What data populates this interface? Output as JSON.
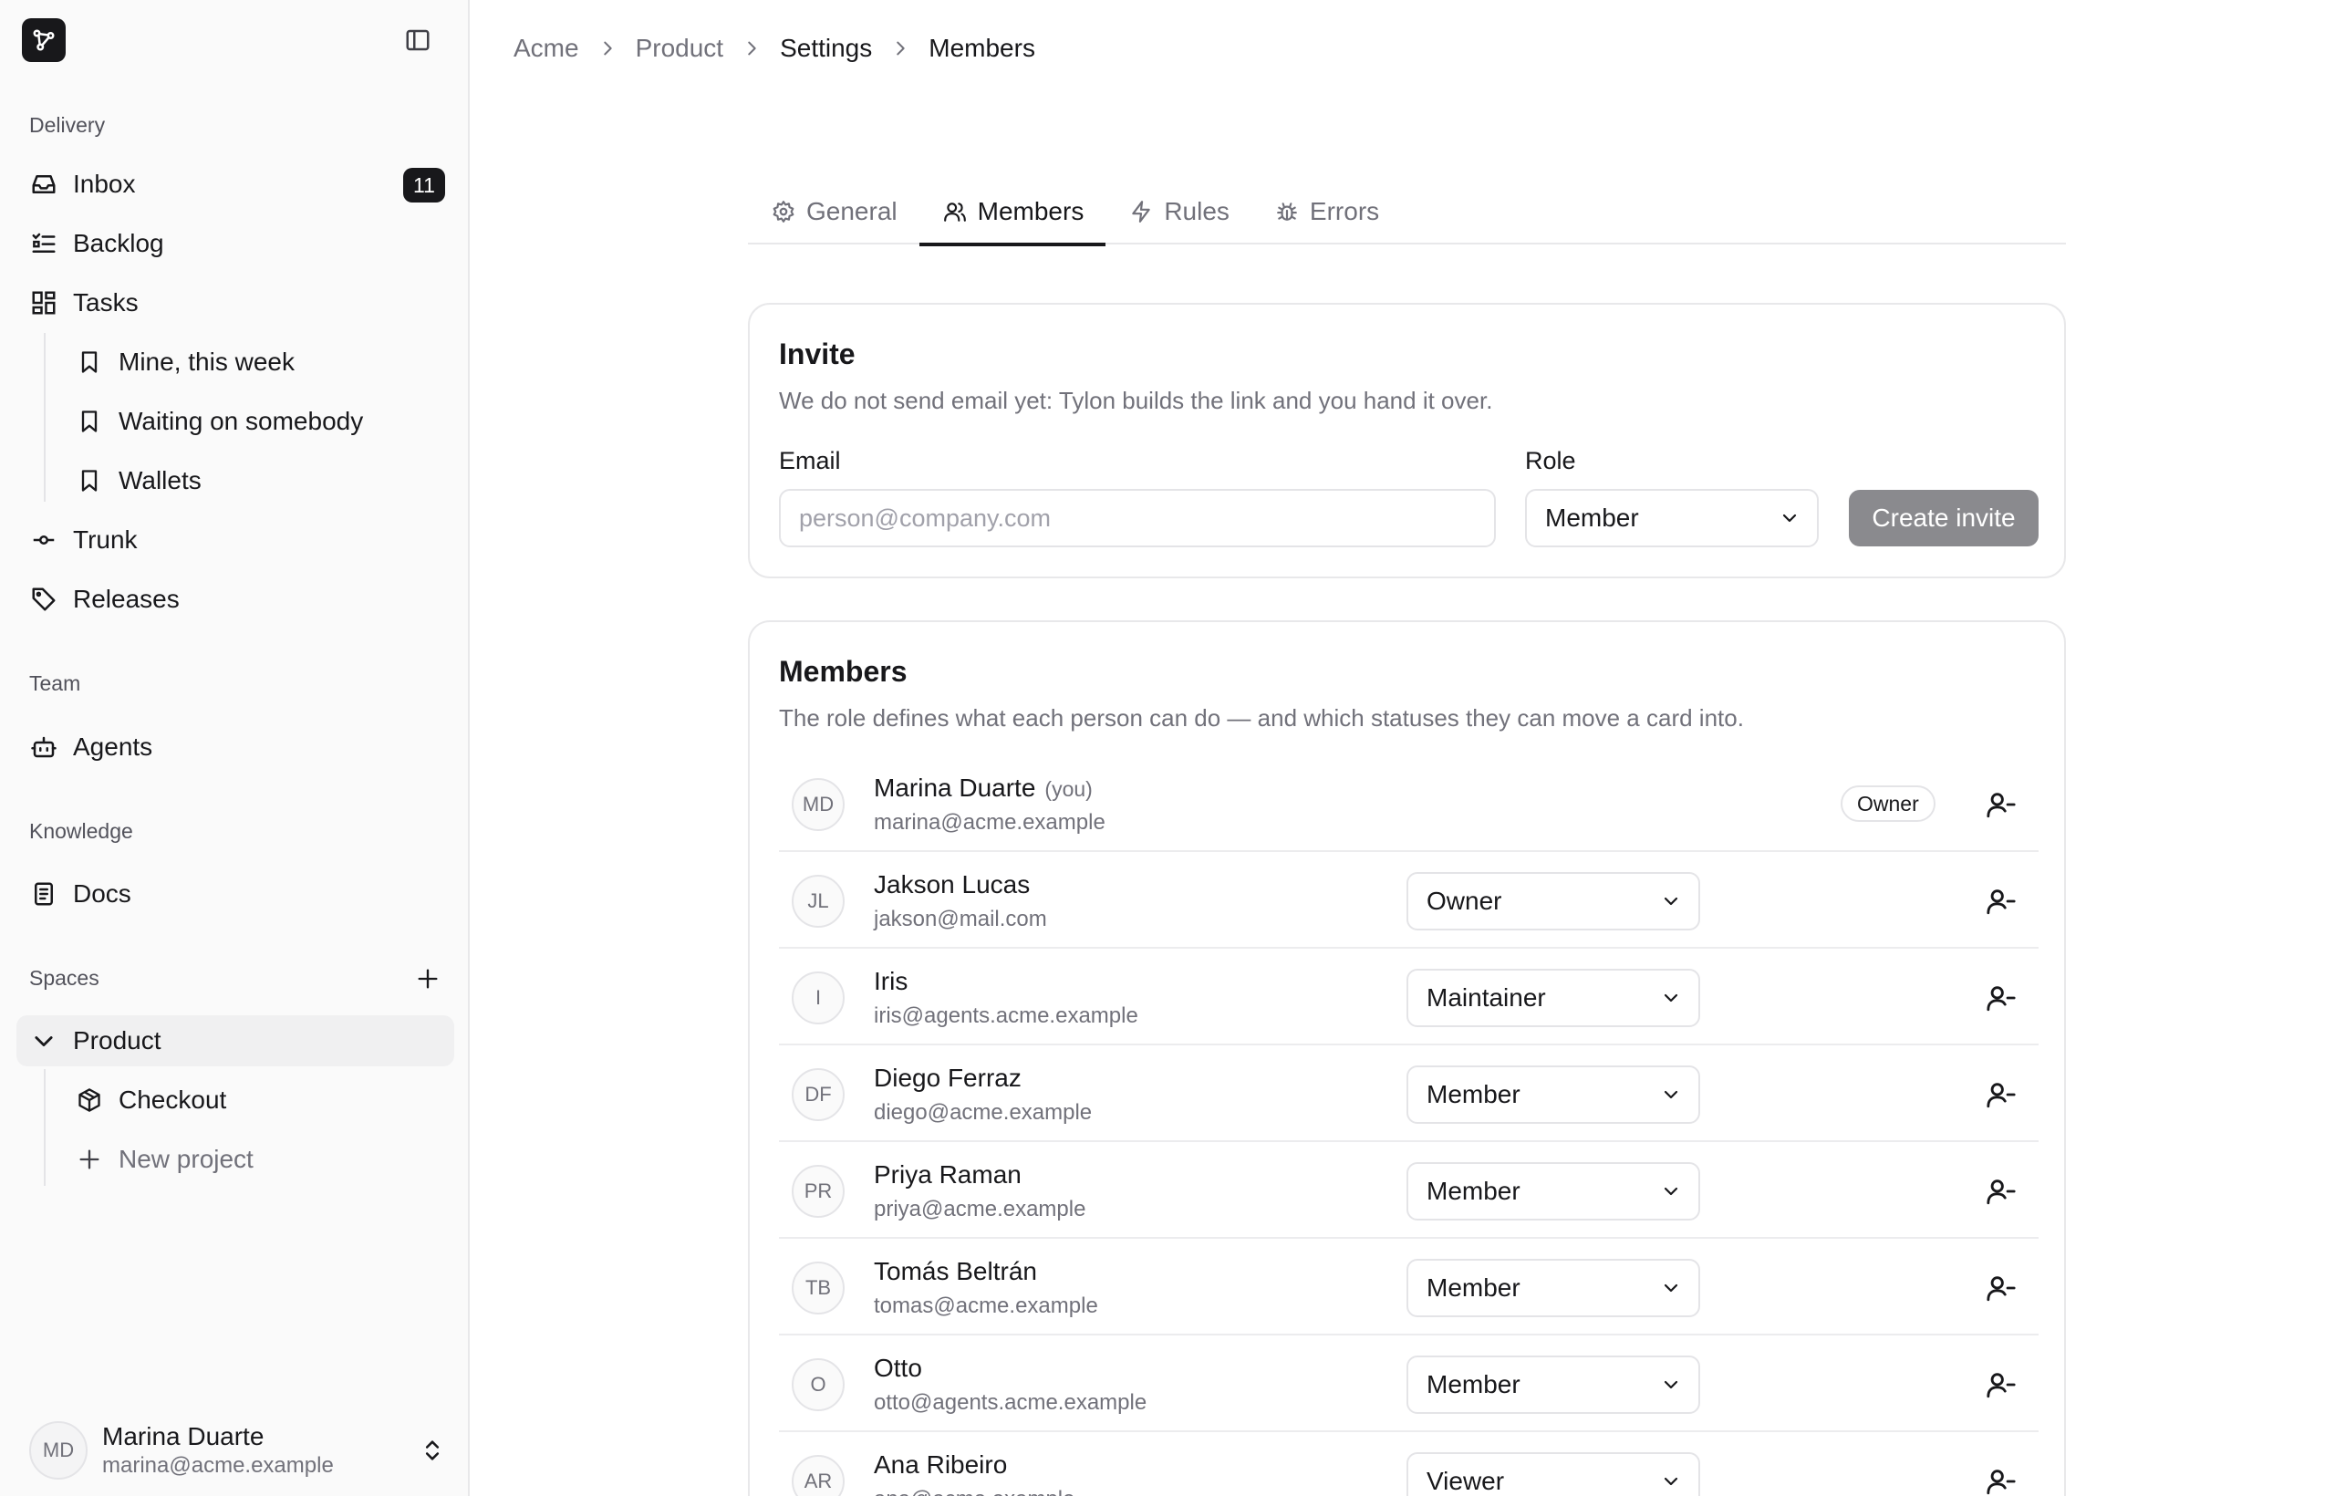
{
  "sidebar": {
    "sections": {
      "delivery": "Delivery",
      "team": "Team",
      "knowledge": "Knowledge",
      "spaces": "Spaces"
    },
    "items": {
      "inbox": {
        "label": "Inbox",
        "count": "11",
        "icon": "inbox-icon"
      },
      "backlog": {
        "label": "Backlog",
        "icon": "list-check-icon"
      },
      "tasks": {
        "label": "Tasks",
        "icon": "grid-icon"
      },
      "mine": {
        "label": "Mine, this week",
        "icon": "bookmark-icon"
      },
      "waiting": {
        "label": "Waiting on somebody",
        "icon": "bookmark-icon"
      },
      "wallets": {
        "label": "Wallets",
        "icon": "bookmark-icon"
      },
      "trunk": {
        "label": "Trunk",
        "icon": "commit-icon"
      },
      "releases": {
        "label": "Releases",
        "icon": "tag-icon"
      },
      "agents": {
        "label": "Agents",
        "icon": "bot-icon"
      },
      "docs": {
        "label": "Docs",
        "icon": "document-icon"
      },
      "product": {
        "label": "Product",
        "icon": "chevron-down-icon"
      },
      "checkout": {
        "label": "Checkout",
        "icon": "package-icon"
      },
      "new_project": {
        "label": "New project",
        "icon": "plus-icon"
      }
    },
    "user": {
      "initials": "MD",
      "name": "Marina Duarte",
      "email": "marina@acme.example"
    }
  },
  "breadcrumb": [
    "Acme",
    "Product",
    "Settings",
    "Members"
  ],
  "tabs": [
    {
      "label": "General",
      "icon": "gear-icon",
      "active": false
    },
    {
      "label": "Members",
      "icon": "users-icon",
      "active": true
    },
    {
      "label": "Rules",
      "icon": "bolt-icon",
      "active": false
    },
    {
      "label": "Errors",
      "icon": "bug-icon",
      "active": false
    }
  ],
  "invite": {
    "title": "Invite",
    "description": "We do not send email yet: Tylon builds the link and you hand it over.",
    "email_label": "Email",
    "email_placeholder": "person@company.com",
    "email_value": "",
    "role_label": "Role",
    "role_value": "Member",
    "submit_label": "Create invite"
  },
  "members": {
    "title": "Members",
    "description": "The role defines what each person can do — and which statuses they can move a card into.",
    "you_label": "(you)",
    "rows": [
      {
        "initials": "MD",
        "name": "Marina Duarte",
        "email": "marina@acme.example",
        "role": "Owner",
        "is_you": true
      },
      {
        "initials": "JL",
        "name": "Jakson Lucas",
        "email": "jakson@mail.com",
        "role": "Owner",
        "is_you": false
      },
      {
        "initials": "I",
        "name": "Iris",
        "email": "iris@agents.acme.example",
        "role": "Maintainer",
        "is_you": false
      },
      {
        "initials": "DF",
        "name": "Diego Ferraz",
        "email": "diego@acme.example",
        "role": "Member",
        "is_you": false
      },
      {
        "initials": "PR",
        "name": "Priya Raman",
        "email": "priya@acme.example",
        "role": "Member",
        "is_you": false
      },
      {
        "initials": "TB",
        "name": "Tomás Beltrán",
        "email": "tomas@acme.example",
        "role": "Member",
        "is_you": false
      },
      {
        "initials": "O",
        "name": "Otto",
        "email": "otto@agents.acme.example",
        "role": "Member",
        "is_you": false
      },
      {
        "initials": "AR",
        "name": "Ana Ribeiro",
        "email": "ana@acme.example",
        "role": "Viewer",
        "is_you": false
      }
    ]
  },
  "colors": {
    "accent": "#18181b",
    "muted_text": "#71717a",
    "border": "#e8e8ea",
    "button_disabled": "#8a8a8e"
  }
}
